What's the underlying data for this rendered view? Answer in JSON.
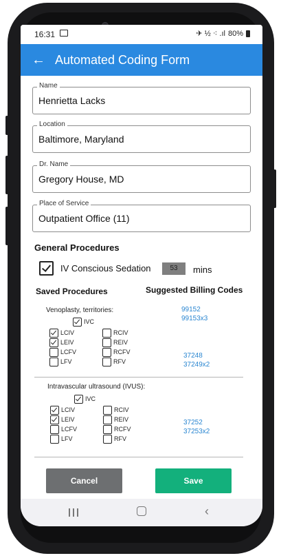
{
  "status": {
    "time": "16:31",
    "icons": "✈ ½ ⁖ .ıl",
    "battery": "80%"
  },
  "appbar": {
    "back_icon": "←",
    "title": "Automated Coding Form"
  },
  "form": {
    "name_label": "Name",
    "name_value": "Henrietta Lacks",
    "location_label": "Location",
    "location_value": "Baltimore, Maryland",
    "doctor_label": "Dr. Name",
    "doctor_value": "Gregory House, MD",
    "pos_label": "Place of Service",
    "pos_value": "Outpatient Office (11)"
  },
  "general": {
    "title": "General Procedures",
    "sedation_label": "IV Conscious Sedation",
    "sedation_minutes": "53",
    "minutes_unit": "mins"
  },
  "headers": {
    "saved": "Saved Procedures",
    "billing": "Suggested Billing Codes"
  },
  "venoplasty": {
    "title": "Venoplasty, territories:",
    "ivc": "IVC",
    "left": [
      "LCIV",
      "LEIV",
      "LCFV",
      "LFV"
    ],
    "right": [
      "RCIV",
      "REIV",
      "RCFV",
      "RFV"
    ],
    "codes_a": [
      "99152",
      "99153x3"
    ],
    "codes_b": [
      "37248",
      "37249x2"
    ]
  },
  "ivus": {
    "title": "Intravascular ultrasound (IVUS):",
    "ivc": "IVC",
    "left": [
      "LCIV",
      "LEIV",
      "LCFV",
      "LFV"
    ],
    "right": [
      "RCIV",
      "REIV",
      "RCFV",
      "RFV"
    ],
    "codes": [
      "37252",
      "37253x2"
    ]
  },
  "buttons": {
    "cancel": "Cancel",
    "save": "Save"
  }
}
